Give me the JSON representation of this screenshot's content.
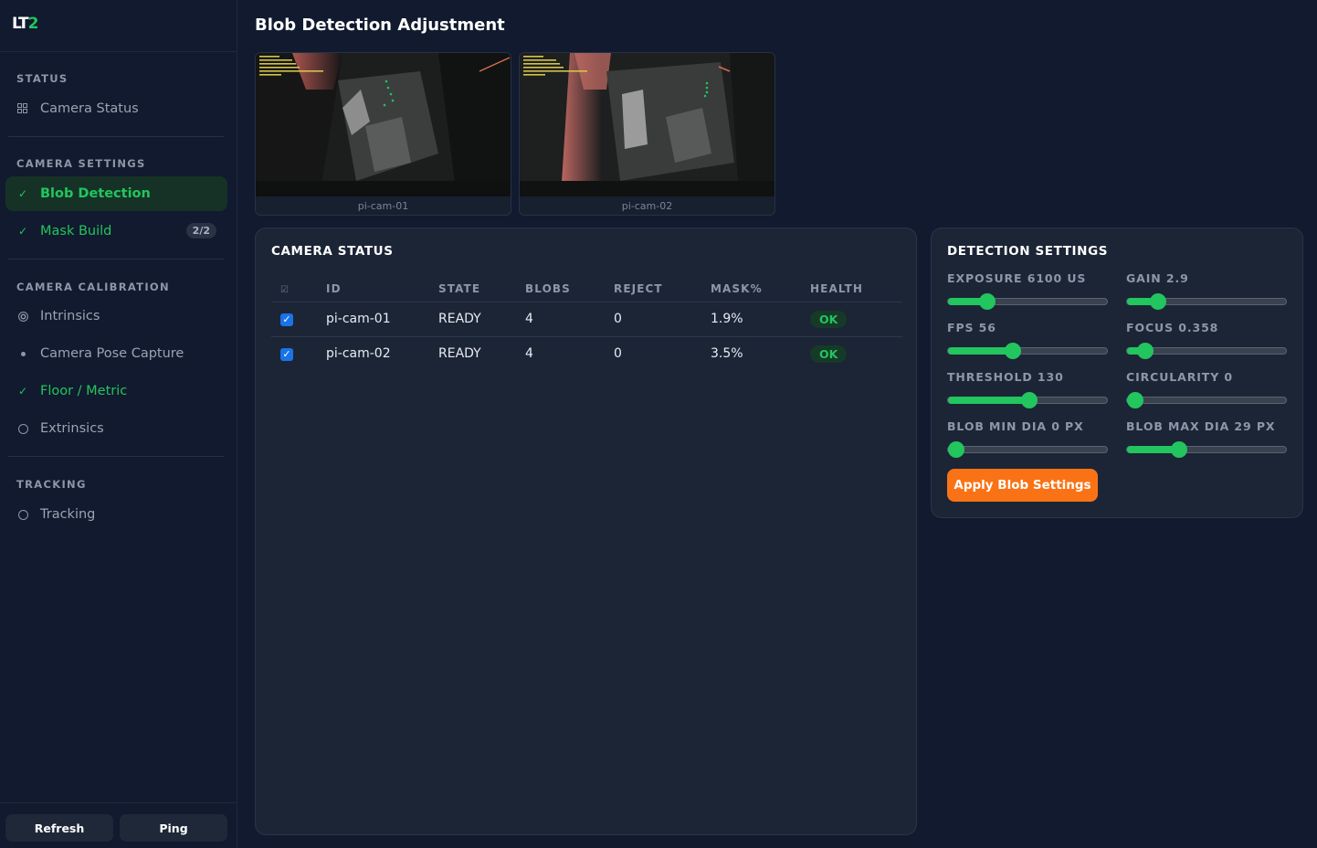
{
  "app": {
    "logo_main": "LT",
    "logo_accent": "2"
  },
  "sidebar": {
    "sections": {
      "status": "STATUS",
      "camera_settings": "CAMERA SETTINGS",
      "camera_calibration": "CAMERA CALIBRATION",
      "tracking": "TRACKING"
    },
    "items": {
      "camera_status": {
        "label": "Camera Status",
        "icon": "grid-icon"
      },
      "blob_detection": {
        "label": "Blob Detection",
        "icon": "check-icon",
        "check": "✓",
        "active": true
      },
      "mask_build": {
        "label": "Mask Build",
        "icon": "check-icon",
        "check": "✓",
        "badge": "2/2"
      },
      "intrinsics": {
        "label": "Intrinsics",
        "icon": "target-icon"
      },
      "camera_pose_capture": {
        "label": "Camera Pose Capture",
        "icon": "dot-icon"
      },
      "floor_metric": {
        "label": "Floor / Metric",
        "icon": "check-icon",
        "check": "✓"
      },
      "extrinsics": {
        "label": "Extrinsics",
        "icon": "circle-icon"
      },
      "tracking": {
        "label": "Tracking",
        "icon": "circle-icon"
      }
    },
    "footer": {
      "refresh_label": "Refresh",
      "ping_label": "Ping"
    }
  },
  "main": {
    "title": "Blob Detection Adjustment",
    "cameras": [
      {
        "label": "pi-cam-01"
      },
      {
        "label": "pi-cam-02"
      }
    ],
    "camera_status": {
      "title": "CAMERA STATUS",
      "header_check": "☑",
      "columns": [
        "ID",
        "STATE",
        "BLOBS",
        "REJECT",
        "MASK%",
        "HEALTH"
      ],
      "rows": [
        {
          "checked": true,
          "check": "✓",
          "id": "pi-cam-01",
          "state": "READY",
          "blobs": "4",
          "reject": "0",
          "mask": "1.9%",
          "health": "OK"
        },
        {
          "checked": true,
          "check": "✓",
          "id": "pi-cam-02",
          "state": "READY",
          "blobs": "4",
          "reject": "0",
          "mask": "3.5%",
          "health": "OK"
        }
      ]
    },
    "detection_settings": {
      "title": "DETECTION SETTINGS",
      "sliders": [
        {
          "label": "EXPOSURE 6100 US",
          "fraction": 0.22
        },
        {
          "label": "GAIN 2.9",
          "fraction": 0.16
        },
        {
          "label": "FPS 56",
          "fraction": 0.4
        },
        {
          "label": "FOCUS 0.358",
          "fraction": 0.07
        },
        {
          "label": "THRESHOLD 130",
          "fraction": 0.51
        },
        {
          "label": "CIRCULARITY 0",
          "fraction": 0.0
        },
        {
          "label": "BLOB MIN DIA 0 PX",
          "fraction": 0.0
        },
        {
          "label": "BLOB MAX DIA 29 PX",
          "fraction": 0.31
        }
      ],
      "apply_label": "Apply Blob Settings"
    }
  },
  "colors": {
    "accent": "#22c55e",
    "action": "#f97316",
    "background": "#111a2e",
    "panel": "#1b2536"
  }
}
